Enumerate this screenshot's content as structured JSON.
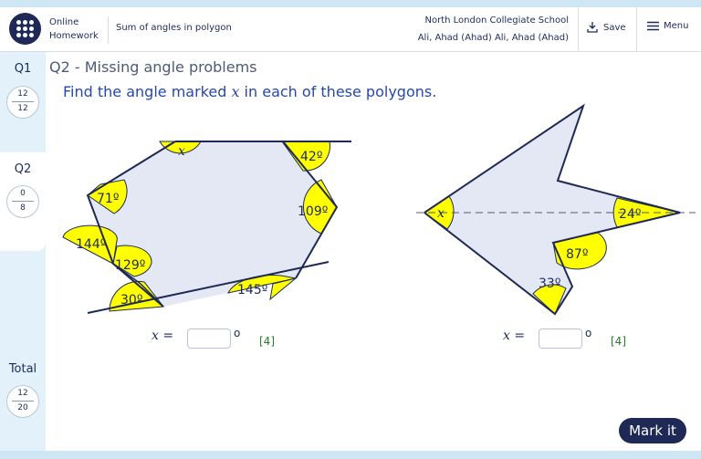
{
  "app": {
    "brand_line1": "Online",
    "brand_line2": "Homework",
    "assignment_title": "Sum of angles in polygon",
    "school": "North London Collegiate School",
    "user": "Ali, Ahad (Ahad) Ali, Ahad (Ahad)",
    "save_label": "Save",
    "menu_label": "Menu"
  },
  "sidebar": {
    "questions": [
      {
        "label": "Q1",
        "score": "12",
        "total": "12"
      },
      {
        "label": "Q2",
        "score": "0",
        "total": "8"
      }
    ],
    "total": {
      "label": "Total",
      "score": "12",
      "total": "20"
    }
  },
  "question": {
    "heading": "Q2 - Missing angle problems",
    "instruction_before": "Find the angle marked ",
    "instruction_var": "x",
    "instruction_after": " in each of these polygons.",
    "answers": [
      {
        "label": "x =",
        "value": "",
        "unit": "o",
        "marks": "[4]"
      },
      {
        "label": "x =",
        "value": "",
        "unit": "o",
        "marks": "[4]"
      }
    ]
  },
  "figure1": {
    "angles": [
      "x",
      "42º",
      "109º",
      "71º",
      "144º",
      "129º",
      "30º",
      "145º"
    ]
  },
  "figure2": {
    "angles": [
      "x",
      "24º",
      "87º",
      "33º"
    ]
  },
  "colors": {
    "navy": "#1e2a55",
    "angle_fill": "#ffff00",
    "polygon_fill": "#e4e8f4",
    "link_blue": "#2748a8"
  },
  "mark_button": "Mark it"
}
